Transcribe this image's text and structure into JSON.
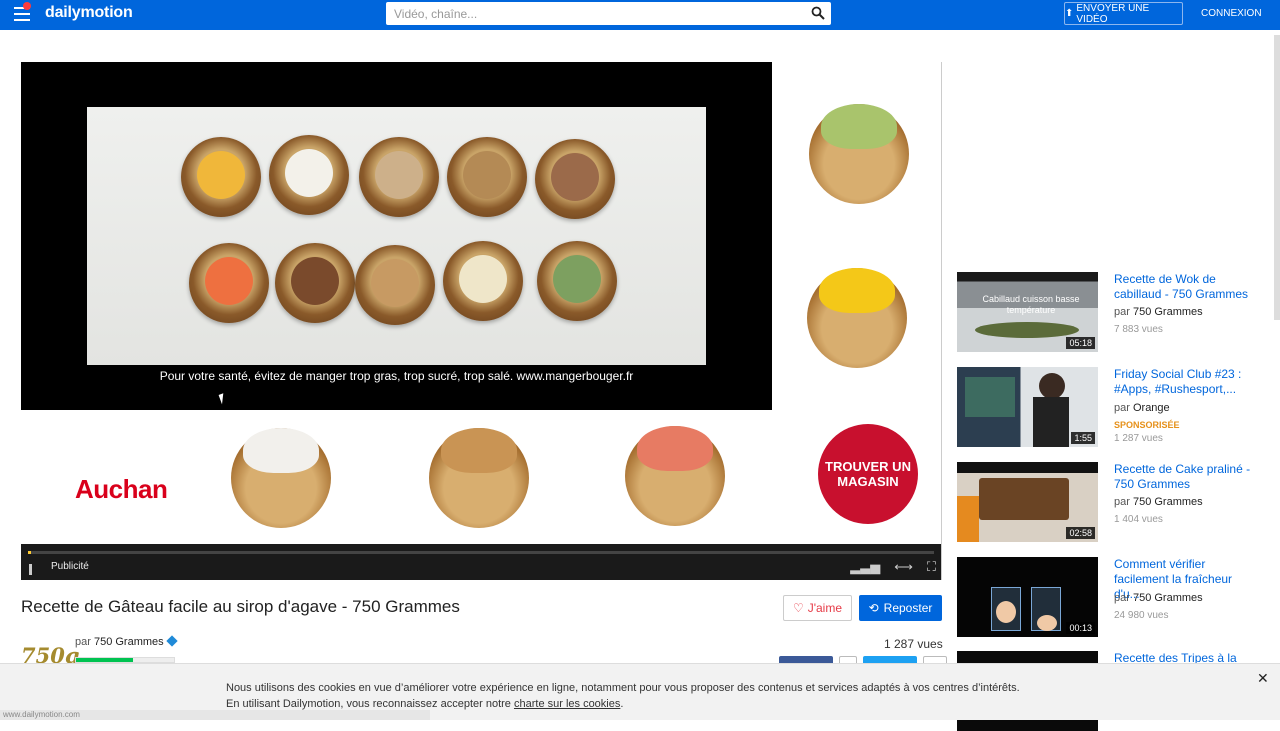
{
  "header": {
    "logo": "dailymotion",
    "search_placeholder": "Vidéo, chaîne...",
    "upload_label": "ENVOYER UNE VIDÉO",
    "login_label": "CONNEXION"
  },
  "player": {
    "disclaimer": "Pour votre santé, évitez de manger trop gras, trop sucré, trop salé. www.mangerbouger.fr",
    "brand": "Auchan",
    "store_button": "TROUVER UN MAGASIN",
    "ad_label": "Publicité",
    "progress_fraction": 0.003,
    "icons": [
      "pause-icon",
      "volume-icon",
      "expand-icon",
      "fullscreen-icon"
    ]
  },
  "video": {
    "title": "Recette de Gâteau facile au sirop d'agave - 750 Grammes",
    "like_label": "J'aime",
    "repost_label": "Reposter",
    "channel_prefix": "par",
    "channel_name": "750 Grammes",
    "brand_logo": "750g",
    "views": "1 287 vues"
  },
  "related": [
    {
      "title": "Recette de Wok de cabillaud - 750 Grammes",
      "by_prefix": "par",
      "by": "750 Grammes",
      "views": "7 883 vues",
      "duration": "05:18",
      "overlay": "Cabillaud cuisson basse température",
      "sponsored": ""
    },
    {
      "title": "Friday Social Club #23 : #Apps, #Rushesport,...",
      "by_prefix": "par",
      "by": "Orange",
      "views": "1 287 vues",
      "duration": "1:55",
      "sponsored": "SPONSORISÉE"
    },
    {
      "title": "Recette de Cake praliné - 750 Grammes",
      "by_prefix": "par",
      "by": "750 Grammes",
      "views": "1 404 vues",
      "duration": "02:58",
      "sponsored": ""
    },
    {
      "title": "Comment vérifier facilement la fraîcheur d'u...",
      "by_prefix": "par",
      "by": "750 Grammes",
      "views": "24 980 vues",
      "duration": "00:13",
      "sponsored": ""
    },
    {
      "title": "Recette des Tripes à la",
      "by_prefix": "",
      "by": "",
      "views": "",
      "duration": "",
      "sponsored": ""
    }
  ],
  "cookie": {
    "line1": "Nous utilisons des cookies en vue d’améliorer votre expérience en ligne, notamment pour vous proposer des contenus et services adaptés à vos centres d’intérêts.",
    "line2_prefix": "En utilisant Dailymotion, vous reconnaissez accepter notre",
    "link": "charte sur les cookies",
    "line2_suffix": ".",
    "close": "✕"
  },
  "status_url": "www.dailymotion.com",
  "colors": {
    "brand": "#0066dc",
    "auchan_red": "#d9001b",
    "sponsored": "#e6911b",
    "like": "#e63b47"
  }
}
